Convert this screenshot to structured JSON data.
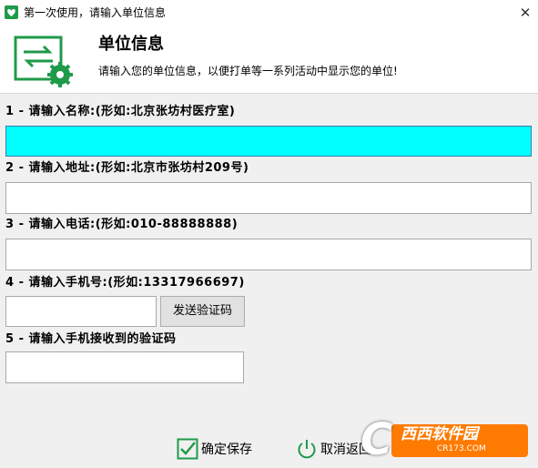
{
  "window": {
    "title": "第一次使用，请输入单位信息",
    "close_glyph": "✕",
    "icon": "app-heart-icon"
  },
  "header": {
    "title": "单位信息",
    "description": "请输入您的单位信息，以便打单等一系列活动中显示您的单位!",
    "logo_icon": "settings-transfer-icon"
  },
  "fields": [
    {
      "label": "1 - 请输入名称:(形如:北京张坊村医疗室)",
      "value": ""
    },
    {
      "label": "2 - 请输入地址:(形如:北京市张坊村209号)",
      "value": ""
    },
    {
      "label": "3 - 请输入电话:(形如:010-88888888)",
      "value": ""
    },
    {
      "label": "4 - 请输入手机号:(形如:13317966697)",
      "value": ""
    },
    {
      "label": "5 - 请输入手机接收到的验证码",
      "value": ""
    }
  ],
  "buttons": {
    "send_code": "发送验证码",
    "confirm": "确定保存",
    "cancel": "取消返回"
  },
  "watermark": {
    "main": "西西软件园",
    "sub": "CR173.COM"
  },
  "colors": {
    "accent_green": "#1f9a4a",
    "active_field": "#00ffff",
    "watermark_orange": "#ff7a00"
  }
}
